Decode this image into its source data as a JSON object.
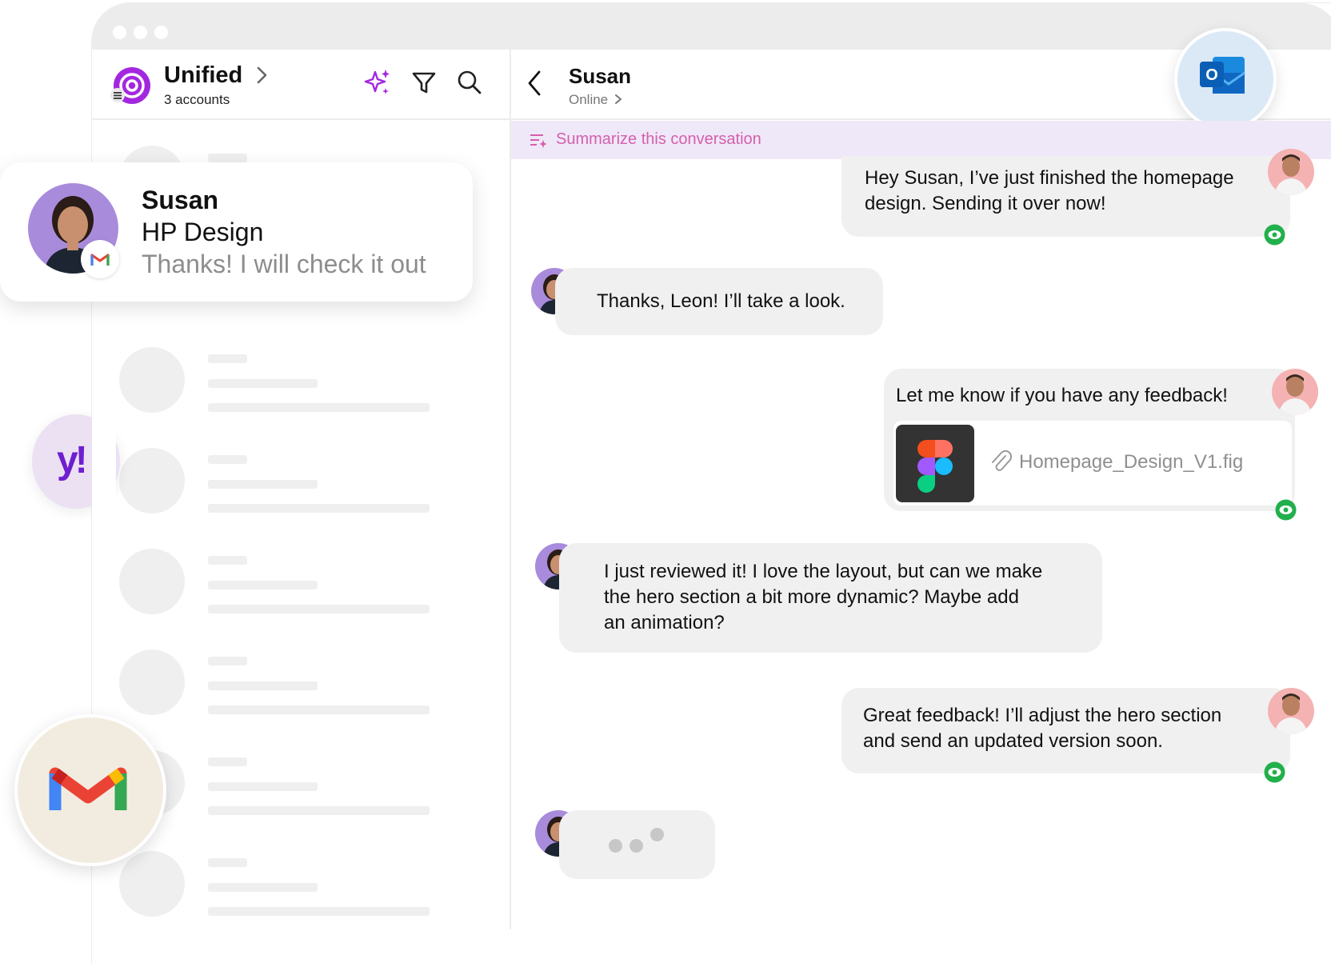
{
  "app": {
    "account_title": "Unified",
    "account_subtitle": "3 accounts"
  },
  "header_icons": [
    "ai-sparkle-icon",
    "filter-icon",
    "search-icon"
  ],
  "contact_card": {
    "name": "Susan",
    "subject": "HP Design",
    "preview": "Thanks! I will check it out"
  },
  "brands": {
    "yahoo_label": "y!"
  },
  "chat": {
    "contact_name": "Susan",
    "status": "Online",
    "summarize_label": "Summarize this conversation",
    "messages": [
      {
        "from": "Leon",
        "text_lines": [
          "Hey Susan, I’ve just finished the homepage",
          "design. Sending it over now!"
        ],
        "seen": true
      },
      {
        "from": "Susan",
        "text_lines": [
          "Thanks, Leon! I’ll take a look."
        ]
      },
      {
        "from": "Leon",
        "text_lines": [
          "Let me know if you have any feedback!"
        ],
        "attachment": "Homepage_Design_V1.fig",
        "seen": true
      },
      {
        "from": "Susan",
        "text_lines": [
          "I just reviewed it! I love the layout, but can we make",
          "the hero section a bit more dynamic? Maybe add",
          "an animation?"
        ]
      },
      {
        "from": "Leon",
        "text_lines": [
          "Great feedback! I’ll adjust the hero section",
          "and send an updated version soon."
        ],
        "seen": true
      }
    ],
    "typing": true
  },
  "colors": {
    "accent_purple": "#a427e0",
    "summarize_pink": "#d55fae",
    "seen_green": "#21b04b",
    "yahoo_purple": "#6e1fd0"
  }
}
